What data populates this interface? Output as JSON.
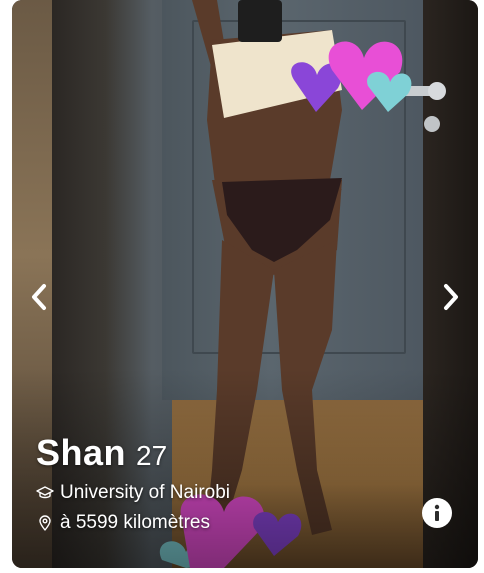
{
  "profile": {
    "name": "Shan",
    "age": "27",
    "school": "University of Nairobi",
    "distance": "à 5599 kilomètres"
  },
  "icons": {
    "prev": "chevron-left-icon",
    "next": "chevron-right-icon",
    "school": "graduation-cap-icon",
    "distance": "location-pin-icon",
    "info": "info-icon"
  },
  "colors": {
    "text": "#ffffff",
    "info_button_bg": "#ffffff",
    "info_button_fg": "#2b2b2b",
    "sticker_pink": "#e84fd6",
    "sticker_purple": "#8a46d8",
    "sticker_teal": "#7fd1d6"
  }
}
